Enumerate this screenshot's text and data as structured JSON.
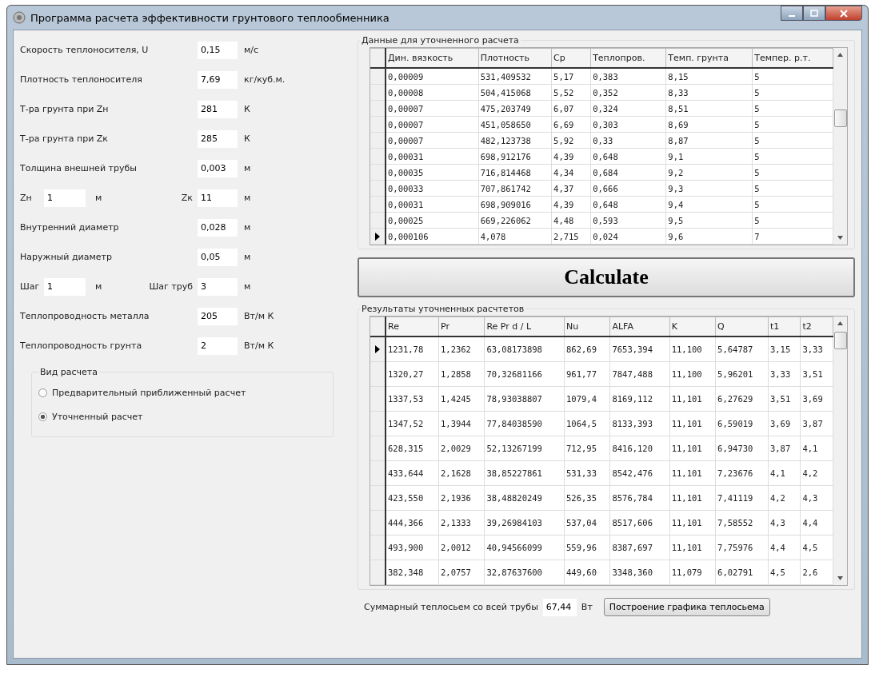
{
  "window": {
    "title": "Программа расчета эффективности грунтового теплообменника"
  },
  "params": [
    {
      "kind": "single",
      "label": "Скорость теплоносителя, U",
      "value": "0,15",
      "unit": "м/с"
    },
    {
      "kind": "single",
      "label": "Плотность теплоносителя",
      "value": "7,69",
      "unit": "кг/куб.м."
    },
    {
      "kind": "single",
      "label": "Т-ра грунта при Zн",
      "value": "281",
      "unit": "К"
    },
    {
      "kind": "single",
      "label": "Т-ра грунта при Zк",
      "value": "285",
      "unit": "К"
    },
    {
      "kind": "single",
      "label": "Толщина внешней трубы",
      "value": "0,003",
      "unit": "м"
    },
    {
      "kind": "pair",
      "label": "Zн",
      "value": "1",
      "unit": "м",
      "label2": "Zк",
      "value2": "11",
      "unit2": "м"
    },
    {
      "kind": "single",
      "label": "Внутренний диаметр",
      "value": "0,028",
      "unit": "м"
    },
    {
      "kind": "single",
      "label": "Наружный диаметр",
      "value": "0,05",
      "unit": "м"
    },
    {
      "kind": "pair",
      "label": "Шаг",
      "value": "1",
      "unit": "м",
      "label2": "Шаг труб",
      "value2": "3",
      "unit2": "м"
    },
    {
      "kind": "single",
      "label": "Теплопроводность металла",
      "value": "205",
      "unit": "Вт/м К"
    },
    {
      "kind": "single",
      "label": "Теплопроводность грунта",
      "value": "2",
      "unit": "Вт/м К"
    }
  ],
  "calc_type": {
    "title": "Вид расчета",
    "options": [
      {
        "label": "Предварительный приближенный расчет",
        "selected": false
      },
      {
        "label": "Уточненный расчет",
        "selected": true
      }
    ]
  },
  "input_table": {
    "title": "Данные для уточненного расчета",
    "columns": [
      "Дин. вязкость",
      "Плотность",
      "Cp",
      "Теплопров.",
      "Темп. грунта",
      "Темпер. р.т."
    ],
    "rows": [
      {
        "selected": false,
        "cells": [
          "0,00009",
          "531,409532",
          "5,17",
          "0,383",
          "8,15",
          "5"
        ]
      },
      {
        "selected": false,
        "cells": [
          "0,00008",
          "504,415068",
          "5,52",
          "0,352",
          "8,33",
          "5"
        ]
      },
      {
        "selected": false,
        "cells": [
          "0,00007",
          "475,203749",
          "6,07",
          "0,324",
          "8,51",
          "5"
        ]
      },
      {
        "selected": false,
        "cells": [
          "0,00007",
          "451,058650",
          "6,69",
          "0,303",
          "8,69",
          "5"
        ]
      },
      {
        "selected": false,
        "cells": [
          "0,00007",
          "482,123738",
          "5,92",
          "0,33",
          "8,87",
          "5"
        ]
      },
      {
        "selected": false,
        "cells": [
          "0,00031",
          "698,912176",
          "4,39",
          "0,648",
          "9,1",
          "5"
        ]
      },
      {
        "selected": false,
        "cells": [
          "0,00035",
          "716,814468",
          "4,34",
          "0,684",
          "9,2",
          "5"
        ]
      },
      {
        "selected": false,
        "cells": [
          "0,00033",
          "707,861742",
          "4,37",
          "0,666",
          "9,3",
          "5"
        ]
      },
      {
        "selected": false,
        "cells": [
          "0,00031",
          "698,909016",
          "4,39",
          "0,648",
          "9,4",
          "5"
        ]
      },
      {
        "selected": false,
        "cells": [
          "0,00025",
          "669,226062",
          "4,48",
          "0,593",
          "9,5",
          "5"
        ]
      },
      {
        "selected": true,
        "cells": [
          "0,000106",
          "4,078",
          "2,715",
          "0,024",
          "9,6",
          "7"
        ]
      }
    ]
  },
  "calculate_button": "Calculate",
  "results_table": {
    "title": "Результаты уточненных расчтетов",
    "columns": [
      "Re",
      "Pr",
      "Re Pr d / L",
      "Nu",
      "ALFA",
      "K",
      "Q",
      "t1",
      "t2"
    ],
    "rows": [
      {
        "selected": true,
        "cells": [
          "1231,78",
          "1,2362",
          "63,08173898",
          "862,69",
          "7653,394",
          "11,100",
          "5,64787",
          "3,15",
          "3,33"
        ]
      },
      {
        "selected": false,
        "cells": [
          "1320,27",
          "1,2858",
          "70,32681166",
          "961,77",
          "7847,488",
          "11,100",
          "5,96201",
          "3,33",
          "3,51"
        ]
      },
      {
        "selected": false,
        "cells": [
          "1337,53",
          "1,4245",
          "78,93038807",
          "1079,4",
          "8169,112",
          "11,101",
          "6,27629",
          "3,51",
          "3,69"
        ]
      },
      {
        "selected": false,
        "cells": [
          "1347,52",
          "1,3944",
          "77,84038590",
          "1064,5",
          "8133,393",
          "11,101",
          "6,59019",
          "3,69",
          "3,87"
        ]
      },
      {
        "selected": false,
        "cells": [
          "628,315",
          "2,0029",
          "52,13267199",
          "712,95",
          "8416,120",
          "11,101",
          "6,94730",
          "3,87",
          "4,1"
        ]
      },
      {
        "selected": false,
        "cells": [
          "433,644",
          "2,1628",
          "38,85227861",
          "531,33",
          "8542,476",
          "11,101",
          "7,23676",
          "4,1",
          "4,2"
        ]
      },
      {
        "selected": false,
        "cells": [
          "423,550",
          "2,1936",
          "38,48820249",
          "526,35",
          "8576,784",
          "11,101",
          "7,41119",
          "4,2",
          "4,3"
        ]
      },
      {
        "selected": false,
        "cells": [
          "444,366",
          "2,1333",
          "39,26984103",
          "537,04",
          "8517,606",
          "11,101",
          "7,58552",
          "4,3",
          "4,4"
        ]
      },
      {
        "selected": false,
        "cells": [
          "493,900",
          "2,0012",
          "40,94566099",
          "559,96",
          "8387,697",
          "11,101",
          "7,75976",
          "4,4",
          "4,5"
        ]
      },
      {
        "selected": false,
        "cells": [
          "382,348",
          "2,0757",
          "32,87637600",
          "449,60",
          "3348,360",
          "11,079",
          "6,02791",
          "4,5",
          "2,6"
        ]
      }
    ]
  },
  "total": {
    "label": "Суммарный теплосьем со всей трубы",
    "value": "67,44",
    "unit": "Вт"
  },
  "chart_button": "Построение графика теплосьема"
}
